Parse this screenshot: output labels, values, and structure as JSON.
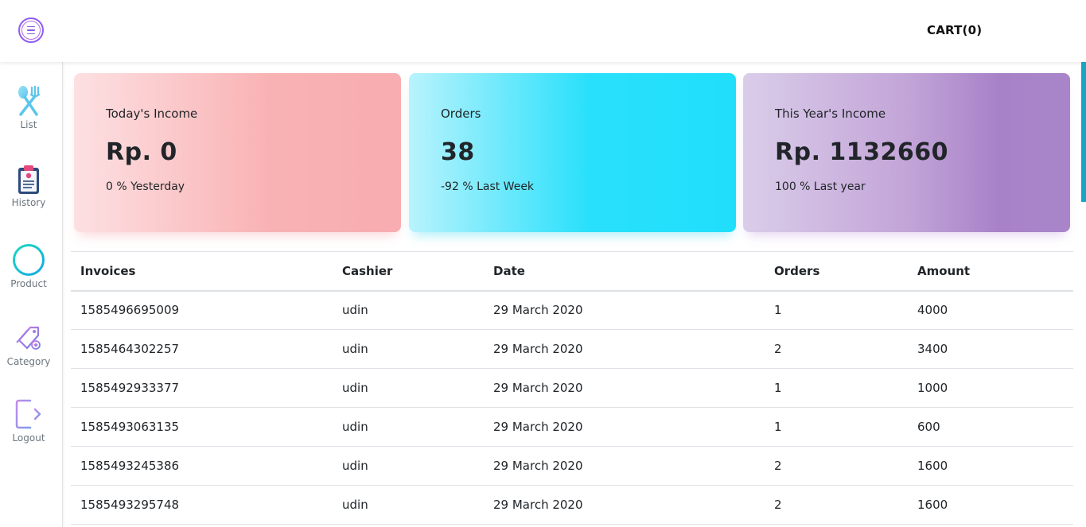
{
  "header": {
    "cart_label": "CART(0)",
    "menu_icon": "hamburger-circle-icon"
  },
  "sidebar": {
    "items": [
      {
        "label": "List",
        "icon": "fork-spoon-icon"
      },
      {
        "label": "History",
        "icon": "clipboard-icon"
      },
      {
        "label": "Product",
        "icon": "plus-circle-icon"
      },
      {
        "label": "Category",
        "icon": "tags-icon"
      },
      {
        "label": "Logout",
        "icon": "logout-icon"
      }
    ]
  },
  "cards": [
    {
      "title": "Today's Income",
      "value": "Rp. 0",
      "sub": "0 % Yesterday"
    },
    {
      "title": "Orders",
      "value": "38",
      "sub": "-92 % Last Week"
    },
    {
      "title": "This Year's Income",
      "value": "Rp. 1132660",
      "sub": "100 % Last year"
    }
  ],
  "table": {
    "headers": [
      "Invoices",
      "Cashier",
      "Date",
      "Orders",
      "Amount"
    ],
    "rows": [
      [
        "1585496695009",
        "udin",
        "29 March 2020",
        "1",
        "4000"
      ],
      [
        "1585464302257",
        "udin",
        "29 March 2020",
        "2",
        "3400"
      ],
      [
        "1585492933377",
        "udin",
        "29 March 2020",
        "1",
        "1000"
      ],
      [
        "1585493063135",
        "udin",
        "29 March 2020",
        "1",
        "600"
      ],
      [
        "1585493245386",
        "udin",
        "29 March 2020",
        "2",
        "1600"
      ],
      [
        "1585493295748",
        "udin",
        "29 March 2020",
        "2",
        "1600"
      ]
    ]
  },
  "colors": {
    "card_income_today": "#f9b2b4",
    "card_orders": "#29e0fb",
    "card_income_year": "#a882c8",
    "accent_scroll": "#1aa3c4"
  }
}
